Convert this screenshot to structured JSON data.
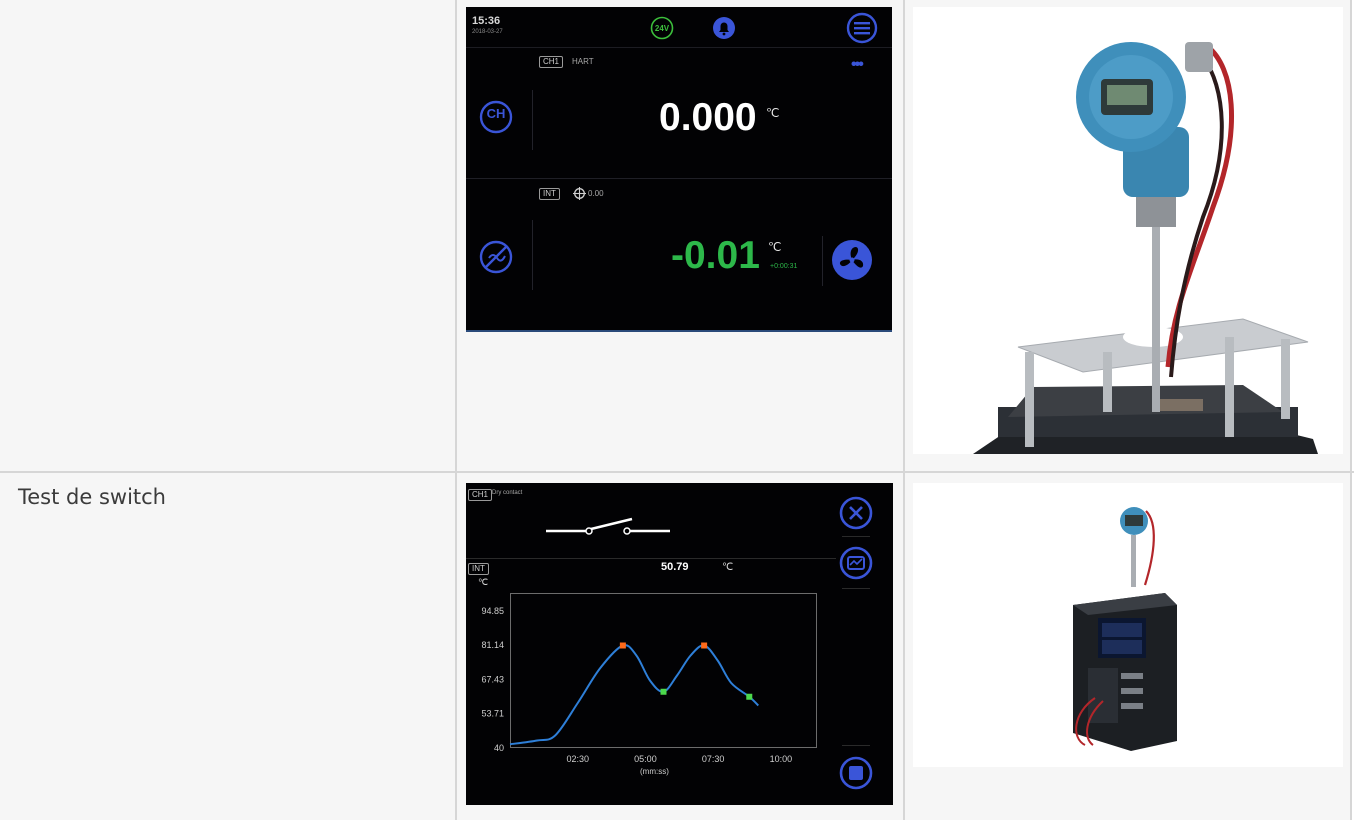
{
  "table": {
    "rows": [
      {
        "label": ""
      },
      {
        "label": "Test de switch"
      }
    ]
  },
  "screen1": {
    "time": "15:36",
    "date": "2018-03-27",
    "icons": [
      "24v-icon",
      "bell-icon",
      "menu-icon"
    ],
    "supply_label": "24V",
    "channel": {
      "tag": "CH1",
      "protocol": "HART",
      "more": "•••",
      "icon_text": "CH",
      "value": "0.000",
      "unit": "℃"
    },
    "internal": {
      "tag": "INT",
      "setpoint": "0.00",
      "value": "-0.01",
      "unit": "℃",
      "timer": "+0:00:31"
    },
    "colors": {
      "accent": "#3a55d8",
      "value_green": "#2db84a",
      "supply_green": "#3cbf3c"
    }
  },
  "screen2": {
    "tag": "CH1",
    "mode": "Dry contact",
    "int_tag": "INT",
    "int_value": "50.79",
    "int_unit": "℃",
    "y_unit": "℃",
    "x_unit": "(mm:ss)"
  },
  "chart_data": {
    "type": "line",
    "title": "",
    "xlabel": "(mm:ss)",
    "ylabel": "℃",
    "y_ticks": [
      "94.85",
      "81.14",
      "67.43",
      "53.71",
      "40"
    ],
    "x_ticks": [
      "02:30",
      "05:00",
      "07:30",
      "10:00"
    ],
    "ylim": [
      40,
      102
    ],
    "xlim": [
      "00:00",
      "11:20"
    ],
    "series": [
      {
        "x": [
          "00:00",
          "01:00",
          "01:40",
          "02:30",
          "03:20",
          "04:10",
          "04:40",
          "05:10",
          "05:40",
          "06:10",
          "06:40",
          "07:10",
          "07:40",
          "08:10",
          "08:50",
          "09:10"
        ],
        "values": [
          41.5,
          43,
          45,
          58,
          72,
          81.0,
          77,
          67,
          62.5,
          69,
          77,
          81.0,
          75,
          66,
          60.5,
          57
        ]
      }
    ],
    "markers": [
      {
        "x": "04:10",
        "y": 81.0,
        "color": "#ff6a1a"
      },
      {
        "x": "05:40",
        "y": 62.5,
        "color": "#4cd94c"
      },
      {
        "x": "07:10",
        "y": 81.0,
        "color": "#ff6a1a"
      },
      {
        "x": "08:50",
        "y": 60.5,
        "color": "#4cd94c"
      }
    ],
    "grid": false,
    "line_color": "#2e7fd8"
  }
}
